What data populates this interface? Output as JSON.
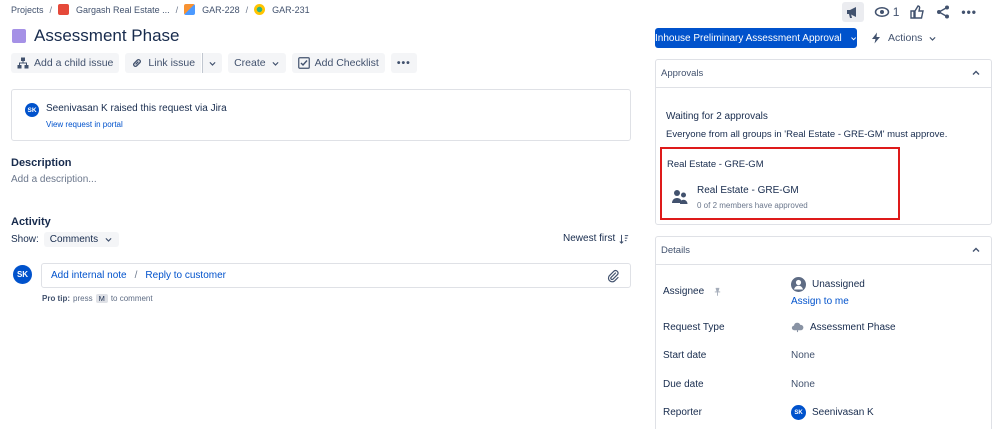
{
  "breadcrumb": {
    "projects": "Projects",
    "project": "Gargash Real Estate ...",
    "parent": "GAR-228",
    "issue": "GAR-231"
  },
  "top_icons": {
    "watch_count": "1"
  },
  "title": "Assessment Phase",
  "toolbar": {
    "add_child": "Add a child issue",
    "link_issue": "Link issue",
    "create": "Create",
    "add_checklist": "Add Checklist"
  },
  "request": {
    "avatar_initials": "SK",
    "name": "Seenivasan K",
    "raised_text": "raised this request via",
    "channel": "Jira",
    "portal_link": "View request in portal"
  },
  "description": {
    "heading": "Description",
    "placeholder": "Add a description..."
  },
  "activity": {
    "heading": "Activity",
    "show_label": "Show:",
    "show_value": "Comments",
    "sort_label": "Newest first",
    "comment_avatar": "SK",
    "add_internal_note": "Add internal note",
    "separator": "/",
    "reply_to_customer": "Reply to customer",
    "protip_label": "Pro tip:",
    "protip_press": "press",
    "protip_key": "M",
    "protip_tail": "to comment"
  },
  "status_button": "Inhouse Preliminary Assessment Approval",
  "actions_button": "Actions",
  "approvals": {
    "heading": "Approvals",
    "waiting": "Waiting for 2 approvals",
    "rule": "Everyone from all groups in 'Real Estate - GRE-GM' must approve.",
    "group_label": "Real Estate - GRE-GM",
    "group_name": "Real Estate - GRE-GM",
    "group_count": "0 of 2 members have approved"
  },
  "details": {
    "heading": "Details",
    "rows": [
      {
        "label": "Assignee",
        "value": "Unassigned",
        "extra": "Assign to me"
      },
      {
        "label": "Request Type",
        "value": "Assessment Phase"
      },
      {
        "label": "Start date",
        "value": "None"
      },
      {
        "label": "Due date",
        "value": "None"
      },
      {
        "label": "Reporter",
        "value": "Seenivasan K",
        "avatar": "SK"
      }
    ]
  },
  "colors": {
    "primary": "#0052cc",
    "highlight": "#de1a1a",
    "issue_type": "#a591e6"
  }
}
